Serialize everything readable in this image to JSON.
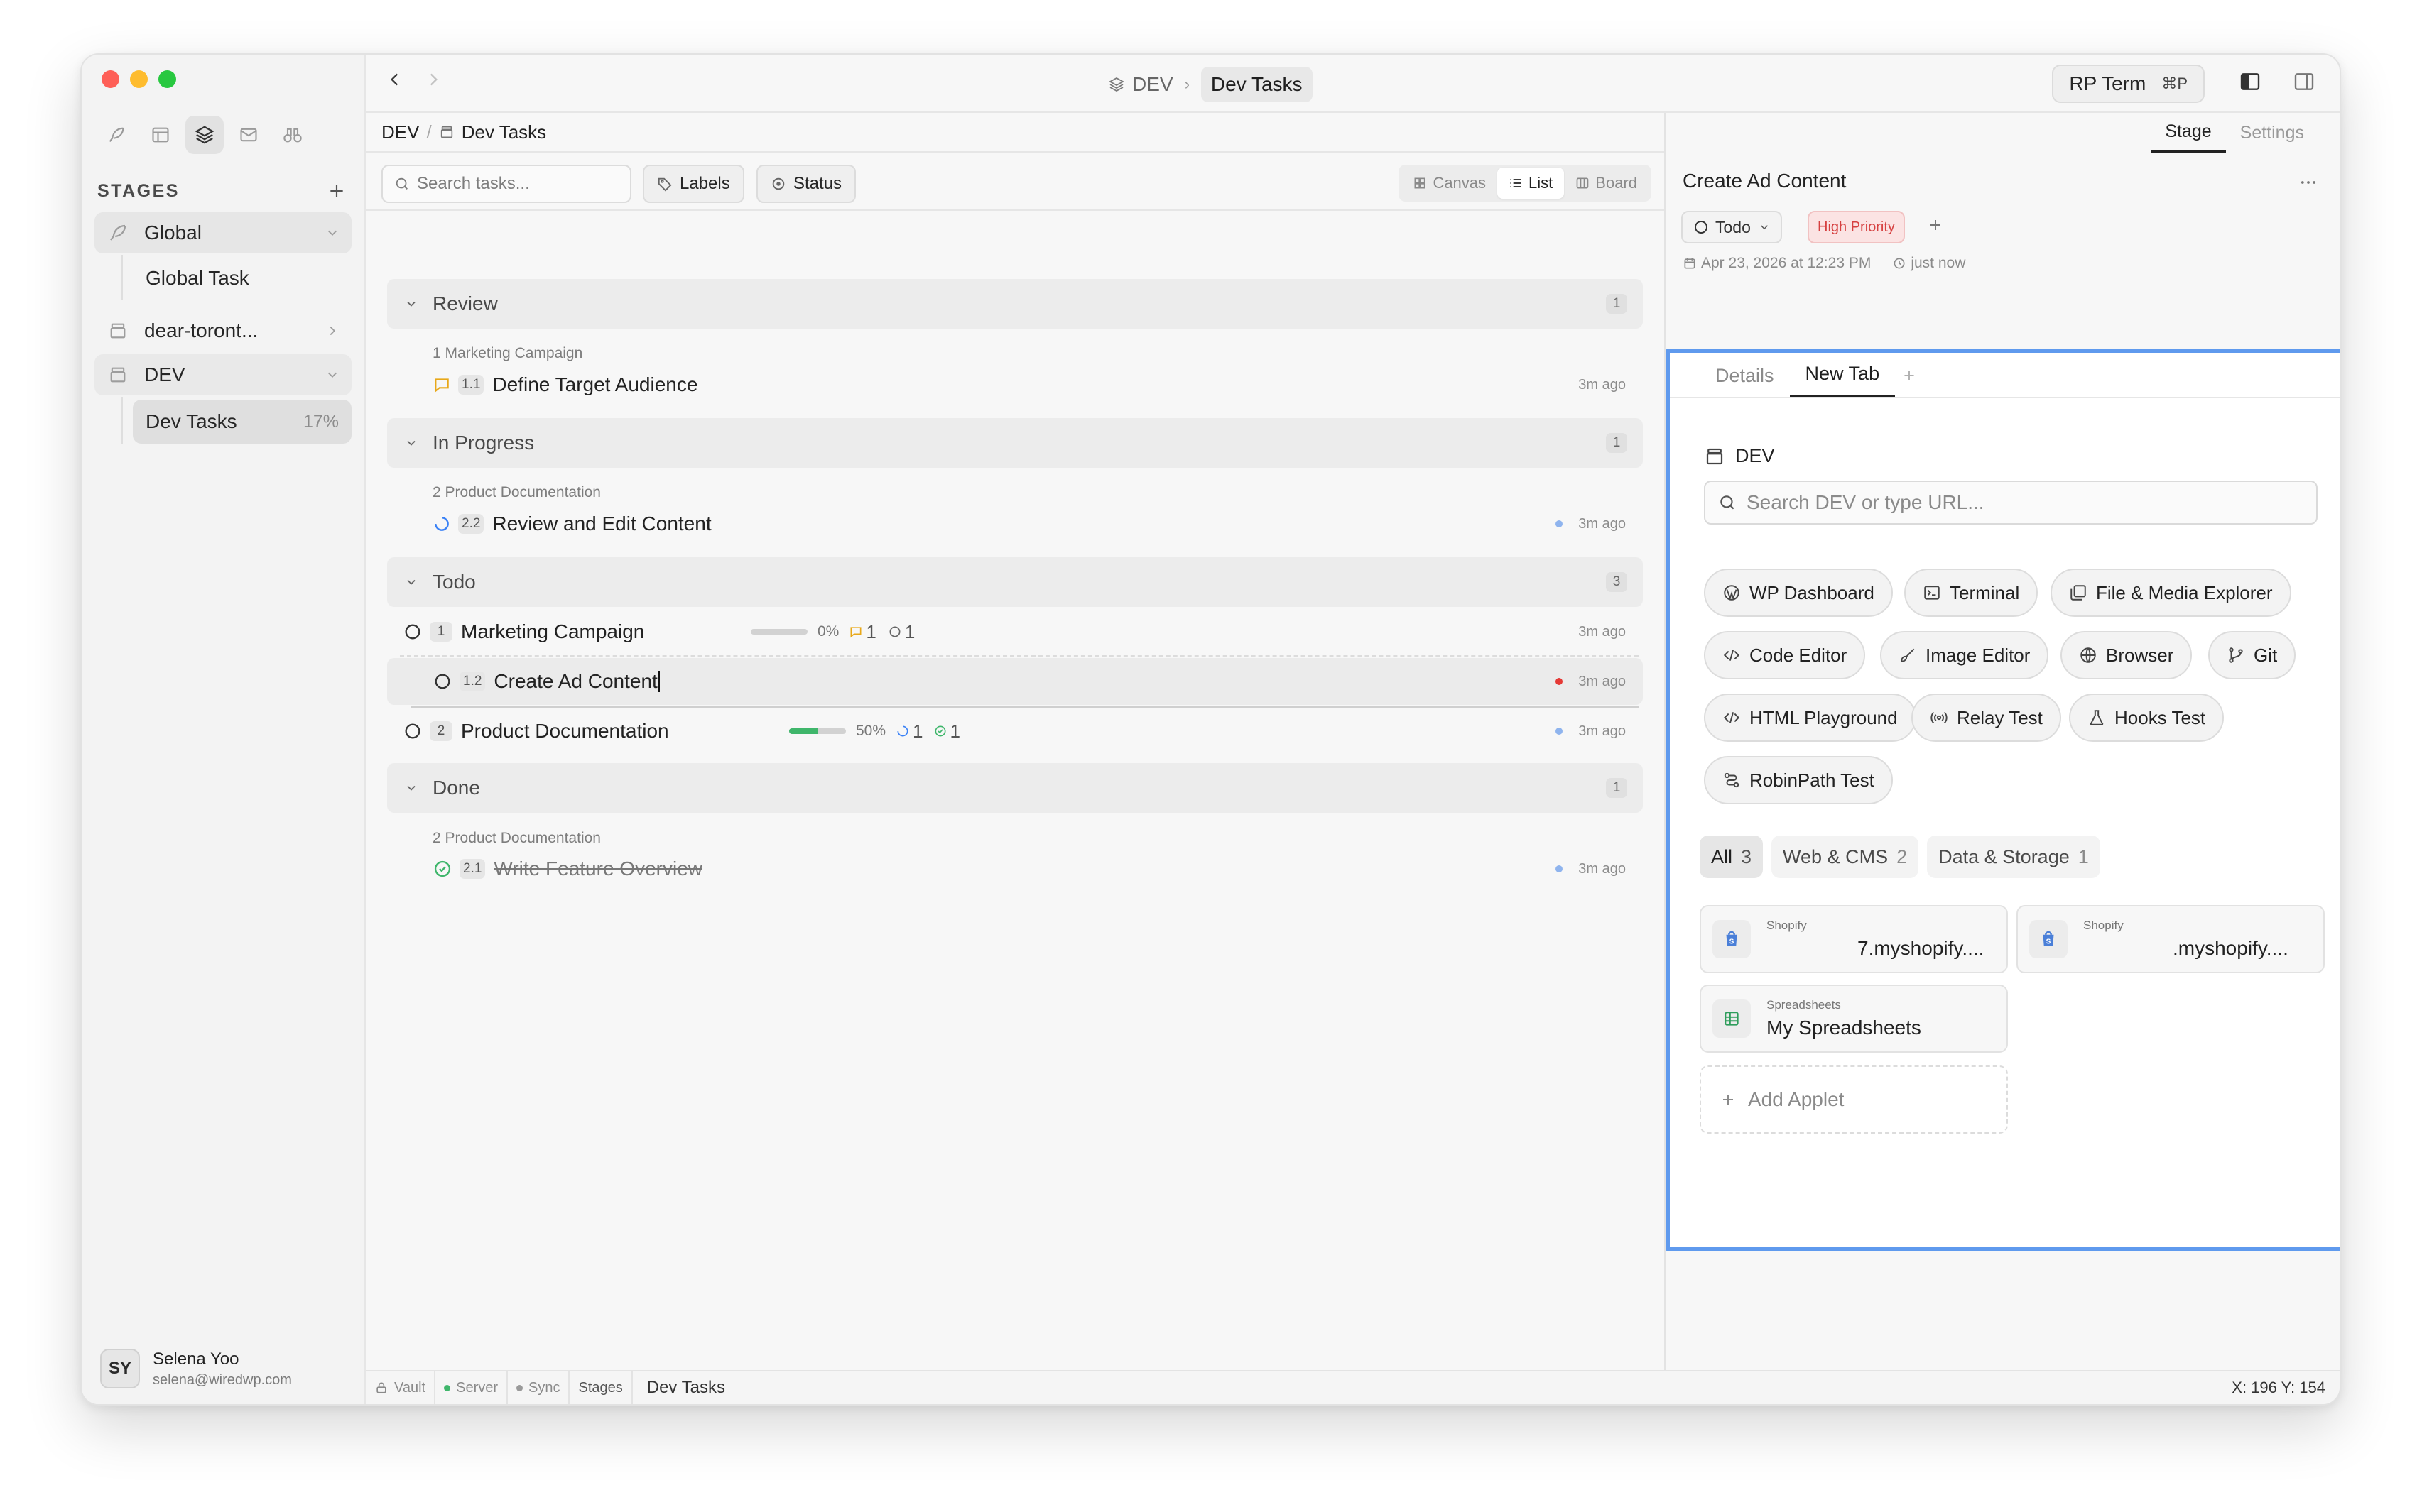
{
  "sidebar": {
    "stages_label": "STAGES",
    "items": [
      {
        "label": "Global"
      },
      {
        "label": "Global Task"
      },
      {
        "label": "dear-toront..."
      },
      {
        "label": "DEV"
      },
      {
        "label": "Dev Tasks",
        "percent": "17%"
      }
    ],
    "user": {
      "initials": "SY",
      "name": "Selena Yoo",
      "email": "selena@wiredwp.com"
    }
  },
  "topbar": {
    "breadcrumb_root": "DEV",
    "breadcrumb_current": "Dev Tasks",
    "rp_term": "RP Term",
    "rp_shortcut": "⌘P"
  },
  "subheader": {
    "root": "DEV",
    "page": "Dev Tasks"
  },
  "toolbar": {
    "search_placeholder": "Search tasks...",
    "labels": "Labels",
    "status": "Status",
    "views": [
      "Canvas",
      "List",
      "Board"
    ],
    "active_view": "List"
  },
  "groups": [
    {
      "name": "Review",
      "count": "1"
    },
    {
      "name": "In Progress",
      "count": "1"
    },
    {
      "name": "Todo",
      "count": "3"
    },
    {
      "name": "Done",
      "count": "1"
    }
  ],
  "tasks": [
    {
      "parent": "1 Marketing Campaign",
      "num": "1.1",
      "title": "Define Target Audience",
      "time": "3m ago"
    },
    {
      "parent": "2 Product Documentation",
      "num": "2.2",
      "title": "Review and Edit Content",
      "time": "3m ago"
    },
    {
      "num": "1",
      "title": "Marketing Campaign",
      "progress": 0,
      "progress_label": "0%",
      "comments": "1",
      "subtasks": "1",
      "time": "3m ago"
    },
    {
      "num": "1.2",
      "title": "Create Ad Content",
      "time": "3m ago"
    },
    {
      "num": "2",
      "title": "Product Documentation",
      "progress": 50,
      "progress_label": "50%",
      "in_progress": "1",
      "done": "1",
      "time": "3m ago"
    },
    {
      "parent": "2 Product Documentation",
      "num": "2.1",
      "title": "Write Feature Overview",
      "time": "3m ago"
    }
  ],
  "statusbar": {
    "items": [
      "Vault",
      "Server",
      "Sync",
      "Stages"
    ],
    "current": "Dev Tasks",
    "coords": "X: 196 Y: 154"
  },
  "panel": {
    "tabs": [
      "Stage",
      "Settings"
    ],
    "active_tab": "Stage",
    "title": "Create Ad Content",
    "status": "Todo",
    "priority": "High Priority",
    "date": "Apr 23, 2026 at 12:23 PM",
    "updated": "just now",
    "inner_tabs": [
      "Details",
      "New Tab"
    ],
    "active_inner_tab": "New Tab",
    "stage_name": "DEV",
    "url_placeholder": "Search DEV or type URL...",
    "applets": [
      "WP Dashboard",
      "Terminal",
      "File & Media Explorer",
      "Code Editor",
      "Image Editor",
      "Browser",
      "Git",
      "HTML Playground",
      "Relay Test",
      "Hooks Test",
      "RobinPath Test"
    ],
    "categories": [
      {
        "name": "All",
        "count": "3"
      },
      {
        "name": "Web & CMS",
        "count": "2"
      },
      {
        "name": "Data & Storage",
        "count": "1"
      }
    ],
    "cards": [
      {
        "type": "Shopify",
        "name": "7.myshopify...."
      },
      {
        "type": "Shopify",
        "name": ".myshopify...."
      },
      {
        "type": "Spreadsheets",
        "name": "My Spreadsheets"
      }
    ],
    "add_applet": "Add Applet"
  },
  "colors": {
    "accent_border": "#5f9aee",
    "priority": "#d64040",
    "progress": "#3fb66b"
  }
}
